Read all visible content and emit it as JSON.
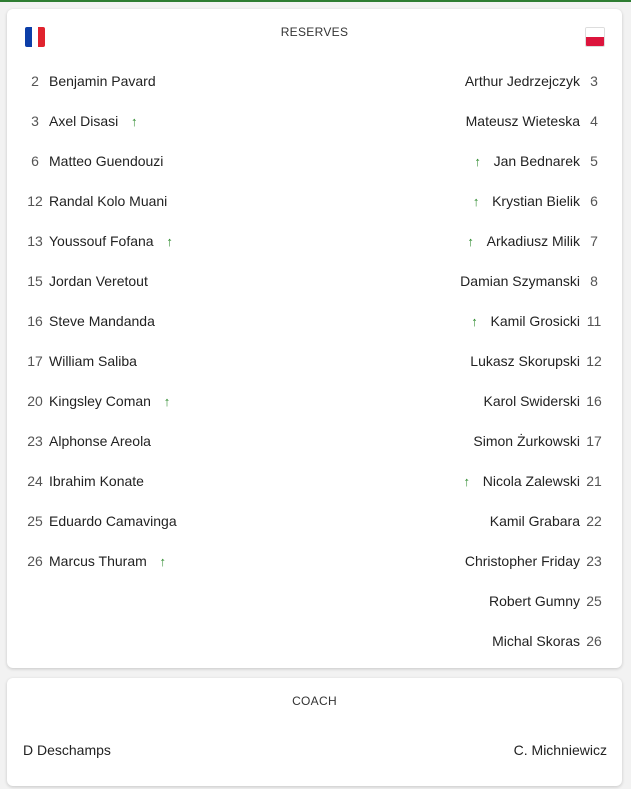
{
  "reserves": {
    "title": "RESERVES",
    "home_team_flag": "France",
    "away_team_flag": "Poland",
    "home": [
      {
        "number": "2",
        "name": "Benjamin Pavard",
        "subbed_in": false
      },
      {
        "number": "3",
        "name": "Axel Disasi",
        "subbed_in": true
      },
      {
        "number": "6",
        "name": "Matteo Guendouzi",
        "subbed_in": false
      },
      {
        "number": "12",
        "name": "Randal Kolo Muani",
        "subbed_in": false
      },
      {
        "number": "13",
        "name": "Youssouf Fofana",
        "subbed_in": true
      },
      {
        "number": "15",
        "name": "Jordan Veretout",
        "subbed_in": false
      },
      {
        "number": "16",
        "name": "Steve Mandanda",
        "subbed_in": false
      },
      {
        "number": "17",
        "name": "William Saliba",
        "subbed_in": false
      },
      {
        "number": "20",
        "name": "Kingsley Coman",
        "subbed_in": true
      },
      {
        "number": "23",
        "name": "Alphonse Areola",
        "subbed_in": false
      },
      {
        "number": "24",
        "name": "Ibrahim Konate",
        "subbed_in": false
      },
      {
        "number": "25",
        "name": "Eduardo Camavinga",
        "subbed_in": false
      },
      {
        "number": "26",
        "name": "Marcus Thuram",
        "subbed_in": true
      }
    ],
    "away": [
      {
        "number": "3",
        "name": "Arthur Jedrzejczyk",
        "subbed_in": false
      },
      {
        "number": "4",
        "name": "Mateusz Wieteska",
        "subbed_in": false
      },
      {
        "number": "5",
        "name": "Jan Bednarek",
        "subbed_in": true
      },
      {
        "number": "6",
        "name": "Krystian Bielik",
        "subbed_in": true
      },
      {
        "number": "7",
        "name": "Arkadiusz Milik",
        "subbed_in": true
      },
      {
        "number": "8",
        "name": "Damian Szymanski",
        "subbed_in": false
      },
      {
        "number": "11",
        "name": "Kamil Grosicki",
        "subbed_in": true
      },
      {
        "number": "12",
        "name": "Lukasz Skorupski",
        "subbed_in": false
      },
      {
        "number": "16",
        "name": "Karol Swiderski",
        "subbed_in": false
      },
      {
        "number": "17",
        "name": "Simon Żurkowski",
        "subbed_in": false
      },
      {
        "number": "21",
        "name": "Nicola Zalewski",
        "subbed_in": true
      },
      {
        "number": "22",
        "name": "Kamil Grabara",
        "subbed_in": false
      },
      {
        "number": "23",
        "name": "Christopher Friday",
        "subbed_in": false
      },
      {
        "number": "25",
        "name": "Robert Gumny",
        "subbed_in": false
      },
      {
        "number": "26",
        "name": "Michal Skoras",
        "subbed_in": false
      }
    ]
  },
  "coach": {
    "title": "COACH",
    "home": "D Deschamps",
    "away": "C. Michniewicz"
  },
  "icons": {
    "sub_in_arrow": "arrow-up-icon",
    "sub_in_glyph": "↑",
    "sub_in_color": "#2e8b2e"
  },
  "colors": {
    "accent_line": "#2e7d32",
    "card_bg": "#ffffff",
    "page_bg": "#f2f2f2"
  }
}
